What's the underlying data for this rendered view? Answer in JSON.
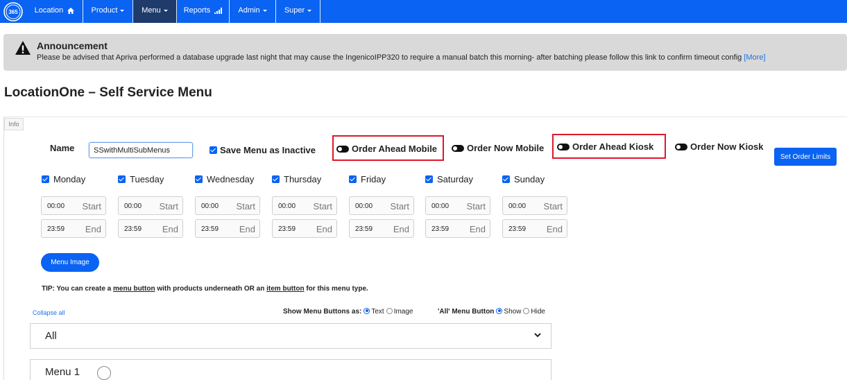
{
  "nav": {
    "logo_text": "365",
    "items": [
      {
        "label": "Location"
      },
      {
        "label": "Product"
      },
      {
        "label": "Menu"
      },
      {
        "label": "Reports"
      },
      {
        "label": "Admin"
      },
      {
        "label": "Super"
      }
    ],
    "colors": {
      "bar": "#0a63f2",
      "active": "#1f3b6b"
    }
  },
  "announcement": {
    "title": "Announcement",
    "text": "Please be advised that Apriva performed a database upgrade last night that may cause the IngenicoIPP320 to require a manual batch this morning- after batching please follow this link to confirm timeout config",
    "more_link": "[More]"
  },
  "page": {
    "title": "LocationOne – Self Service Menu"
  },
  "panel": {
    "tab": "Info"
  },
  "form": {
    "name_label": "Name",
    "name_value": "SSwithMultiSubMenus",
    "save_inactive_label": "Save Menu as Inactive",
    "toggles": {
      "order_ahead_mobile": "Order Ahead Mobile",
      "order_now_mobile": "Order Now Mobile",
      "order_ahead_kiosk": "Order Ahead Kiosk",
      "order_now_kiosk": "Order Now Kiosk"
    },
    "set_order_limits": "Set Order Limits",
    "days": [
      {
        "label": "Monday",
        "start": "00:00",
        "end": "23:59"
      },
      {
        "label": "Tuesday",
        "start": "00:00",
        "end": "23:59"
      },
      {
        "label": "Wednesday",
        "start": "00:00",
        "end": "23:59"
      },
      {
        "label": "Thursday",
        "start": "00:00",
        "end": "23:59"
      },
      {
        "label": "Friday",
        "start": "00:00",
        "end": "23:59"
      },
      {
        "label": "Saturday",
        "start": "00:00",
        "end": "23:59"
      },
      {
        "label": "Sunday",
        "start": "00:00",
        "end": "23:59"
      }
    ],
    "start_placeholder": "Start",
    "end_placeholder": "End",
    "menu_image_button": "Menu Image",
    "tip": {
      "prefix": "TIP: You can create a ",
      "link1": "menu button",
      "middle": " with products underneath OR an ",
      "link2": "item button",
      "suffix": " for this menu type."
    }
  },
  "menu_controls": {
    "collapse_all": "Collapse all",
    "show_as_label": "Show Menu Buttons as:",
    "show_as_options": [
      "Text",
      "Image"
    ],
    "all_button_label": "'All' Menu Button",
    "all_button_options": [
      "Show",
      "Hide"
    ]
  },
  "accordion": {
    "first": "All",
    "second": "Menu 1"
  },
  "accent_colors": {
    "highlight": "#e0162b",
    "link": "#1a73e8"
  }
}
